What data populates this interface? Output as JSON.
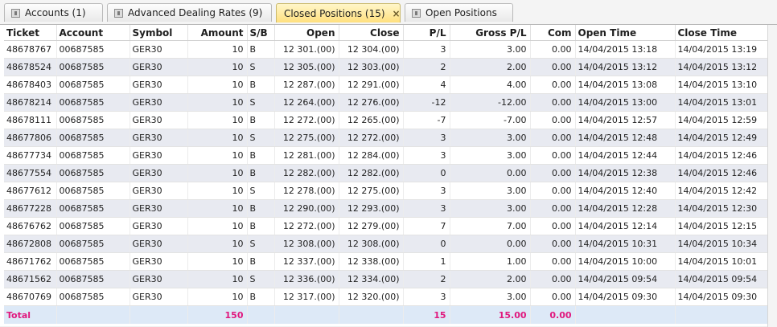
{
  "tabs": [
    {
      "label": "Accounts (1)",
      "active": false
    },
    {
      "label": "Advanced Dealing Rates (9)",
      "active": false
    },
    {
      "label": "Closed Positions (15)",
      "active": true,
      "close": "×"
    },
    {
      "label": "Open Positions",
      "active": false
    }
  ],
  "table": {
    "columns": [
      "Ticket",
      "Account",
      "Symbol",
      "Amount",
      "S/B",
      "Open",
      "Close",
      "P/L",
      "Gross P/L",
      "Com",
      "Open Time",
      "Close Time"
    ],
    "rows": [
      [
        "48678767",
        "00687585",
        "GER30",
        "10",
        "B",
        "12 301.(00)",
        "12 304.(00)",
        "3",
        "3.00",
        "0.00",
        "14/04/2015 13:18",
        "14/04/2015 13:19"
      ],
      [
        "48678524",
        "00687585",
        "GER30",
        "10",
        "S",
        "12 305.(00)",
        "12 303.(00)",
        "2",
        "2.00",
        "0.00",
        "14/04/2015 13:12",
        "14/04/2015 13:12"
      ],
      [
        "48678403",
        "00687585",
        "GER30",
        "10",
        "B",
        "12 287.(00)",
        "12 291.(00)",
        "4",
        "4.00",
        "0.00",
        "14/04/2015 13:08",
        "14/04/2015 13:10"
      ],
      [
        "48678214",
        "00687585",
        "GER30",
        "10",
        "S",
        "12 264.(00)",
        "12 276.(00)",
        "-12",
        "-12.00",
        "0.00",
        "14/04/2015 13:00",
        "14/04/2015 13:01"
      ],
      [
        "48678111",
        "00687585",
        "GER30",
        "10",
        "B",
        "12 272.(00)",
        "12 265.(00)",
        "-7",
        "-7.00",
        "0.00",
        "14/04/2015 12:57",
        "14/04/2015 12:59"
      ],
      [
        "48677806",
        "00687585",
        "GER30",
        "10",
        "S",
        "12 275.(00)",
        "12 272.(00)",
        "3",
        "3.00",
        "0.00",
        "14/04/2015 12:48",
        "14/04/2015 12:49"
      ],
      [
        "48677734",
        "00687585",
        "GER30",
        "10",
        "B",
        "12 281.(00)",
        "12 284.(00)",
        "3",
        "3.00",
        "0.00",
        "14/04/2015 12:44",
        "14/04/2015 12:46"
      ],
      [
        "48677554",
        "00687585",
        "GER30",
        "10",
        "B",
        "12 282.(00)",
        "12 282.(00)",
        "0",
        "0.00",
        "0.00",
        "14/04/2015 12:38",
        "14/04/2015 12:46"
      ],
      [
        "48677612",
        "00687585",
        "GER30",
        "10",
        "S",
        "12 278.(00)",
        "12 275.(00)",
        "3",
        "3.00",
        "0.00",
        "14/04/2015 12:40",
        "14/04/2015 12:42"
      ],
      [
        "48677228",
        "00687585",
        "GER30",
        "10",
        "B",
        "12 290.(00)",
        "12 293.(00)",
        "3",
        "3.00",
        "0.00",
        "14/04/2015 12:28",
        "14/04/2015 12:30"
      ],
      [
        "48676762",
        "00687585",
        "GER30",
        "10",
        "B",
        "12 272.(00)",
        "12 279.(00)",
        "7",
        "7.00",
        "0.00",
        "14/04/2015 12:14",
        "14/04/2015 12:15"
      ],
      [
        "48672808",
        "00687585",
        "GER30",
        "10",
        "S",
        "12 308.(00)",
        "12 308.(00)",
        "0",
        "0.00",
        "0.00",
        "14/04/2015 10:31",
        "14/04/2015 10:34"
      ],
      [
        "48671762",
        "00687585",
        "GER30",
        "10",
        "B",
        "12 337.(00)",
        "12 338.(00)",
        "1",
        "1.00",
        "0.00",
        "14/04/2015 10:00",
        "14/04/2015 10:01"
      ],
      [
        "48671562",
        "00687585",
        "GER30",
        "10",
        "S",
        "12 336.(00)",
        "12 334.(00)",
        "2",
        "2.00",
        "0.00",
        "14/04/2015 09:54",
        "14/04/2015 09:54"
      ],
      [
        "48670769",
        "00687585",
        "GER30",
        "10",
        "B",
        "12 317.(00)",
        "12 320.(00)",
        "3",
        "3.00",
        "0.00",
        "14/04/2015 09:30",
        "14/04/2015 09:30"
      ]
    ],
    "total": {
      "label": "Total",
      "amount": "150",
      "pl": "15",
      "gross": "15.00",
      "com": "0.00"
    }
  },
  "colors": {
    "active_tab": "#ffe07e",
    "total_text": "#e0187e",
    "total_bg": "#dde9f7",
    "stripe": "#e8eaf1"
  }
}
